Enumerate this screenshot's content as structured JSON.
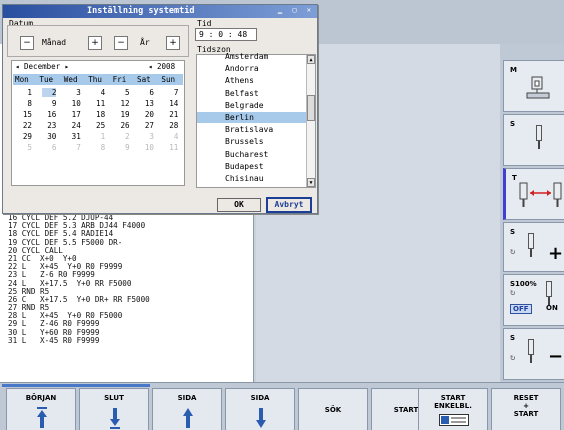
{
  "dialog": {
    "title": "Inställning systemtid",
    "window_controls": "▁ ▢ ✕",
    "datum_label": "Datum",
    "month_label": "Månad",
    "year_label": "År",
    "minus": "−",
    "plus": "+",
    "tid_label": "Tid",
    "time_value": "9 : 0 : 48",
    "tidszon_label": "Tidszon",
    "ok_label": "OK",
    "cancel_label": "Avbryt"
  },
  "calendar": {
    "month_nav": "◂ December ▸",
    "year_nav": "◂ 2008 ▸",
    "weekdays": [
      "Mon",
      "Tue",
      "Wed",
      "Thu",
      "Fri",
      "Sat",
      "Sun"
    ],
    "weeks": [
      [
        "1",
        "2",
        "3",
        "4",
        "5",
        "6",
        "7"
      ],
      [
        "8",
        "9",
        "10",
        "11",
        "12",
        "13",
        "14"
      ],
      [
        "15",
        "16",
        "17",
        "18",
        "19",
        "20",
        "21"
      ],
      [
        "22",
        "23",
        "24",
        "25",
        "26",
        "27",
        "28"
      ],
      [
        "29",
        "30",
        "31",
        "1",
        "2",
        "3",
        "4"
      ],
      [
        "5",
        "6",
        "7",
        "8",
        "9",
        "10",
        "11"
      ]
    ],
    "selected_day": "2"
  },
  "timezones": {
    "items": [
      "Amsterdam",
      "Andorra",
      "Athens",
      "Belfast",
      "Belgrade",
      "Berlin",
      "Bratislava",
      "Brussels",
      "Bucharest",
      "Budapest",
      "Chisinau"
    ],
    "selected": "Berlin"
  },
  "program": {
    "lines": [
      "16 CYCL DEF 5.2 DJUP-44",
      "17 CYCL DEF 5.3 ARB DJ44 F4000",
      "18 CYCL DEF 5.4 RADIE14",
      "19 CYCL DEF 5.5 F5000 DR-",
      "20 CYCL CALL",
      "21 CC  X+0  Y+0",
      "22 L   X+45  Y+0 R0 F9999",
      "23 L   Z-6 R0 F9999",
      "24 L   X+17.5  Y+0 RR F5000",
      "25 RND R5",
      "26 C   X+17.5  Y+0 DR+ RR F5000",
      "27 RND R5",
      "28 L   X+45  Y+0 R0 F5000",
      "29 L   Z-46 R0 F9999",
      "30 L   Y+60 R0 F9999",
      "31 L   X-45 R0 F9999"
    ]
  },
  "right_softkeys": {
    "m": "M",
    "s1": "S",
    "t": "T",
    "s2": "S",
    "s100": "S100%",
    "off": "OFF",
    "on": "ON",
    "s3": "S"
  },
  "bottom_softkeys": {
    "borjan": "BÖRJAN",
    "slut": "SLUT",
    "sida1": "SIDA",
    "sida2": "SIDA",
    "sok": "SÖK",
    "start": "START",
    "start_enkel_1": "START",
    "start_enkel_2": "ENKELBL.",
    "reset_1": "RESET",
    "reset_2": "+",
    "reset_3": "START"
  }
}
